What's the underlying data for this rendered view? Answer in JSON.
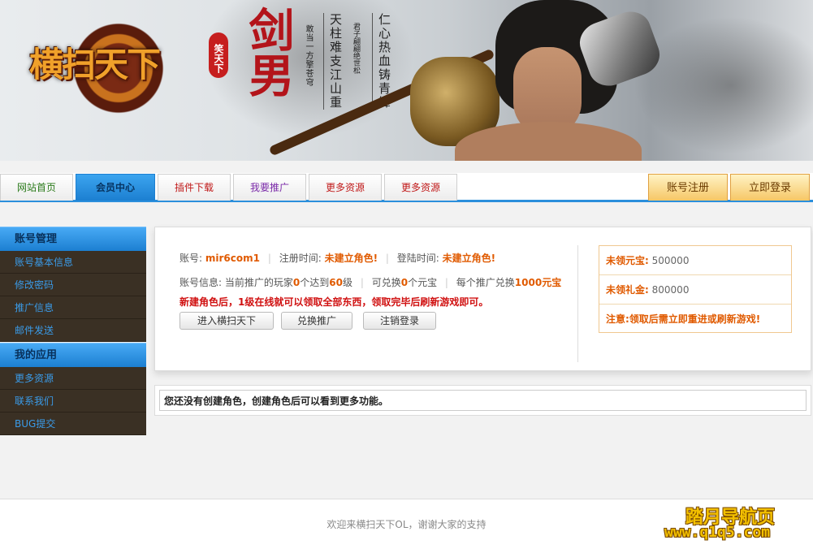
{
  "banner": {
    "logo": "横扫天下",
    "seal": "笑天下",
    "calligraphy": "剑男",
    "verse_small_1": "敢当一方擎苍穹",
    "verse_1": "天柱难支江山重",
    "verse_small_2": "君子翩翩绝世松",
    "verse_2": "仁心热血铸青锋"
  },
  "nav": {
    "tabs": [
      {
        "label": "网站首页",
        "color": "#2a7a1a"
      },
      {
        "label": "会员中心",
        "color": "#073563"
      },
      {
        "label": "插件下载",
        "color": "#c01818"
      },
      {
        "label": "我要推广",
        "color": "#7a2aa8"
      },
      {
        "label": "更多资源",
        "color": "#c01818"
      },
      {
        "label": "更多资源",
        "color": "#c01818"
      }
    ],
    "register": "账号注册",
    "login": "立即登录"
  },
  "sidebar": {
    "section1": "账号管理",
    "items1": [
      "账号基本信息",
      "修改密码",
      "推广信息",
      "邮件发送"
    ],
    "section2": "我的应用",
    "items2": [
      "更多资源",
      "联系我们",
      "BUG提交"
    ]
  },
  "panel": {
    "account_label": "账号:",
    "account": "mir6com1",
    "reg_label": "注册时间:",
    "reg_value": "未建立角色!",
    "login_label": "登陆时间:",
    "login_value": "未建立角色!",
    "info_label": "账号信息:",
    "info_a": "当前推广的玩家",
    "info_n1": "0",
    "info_b": "个达到",
    "info_n2": "60",
    "info_c": "级",
    "info_d": "可兑换",
    "info_n3": "0",
    "info_e": "个元宝",
    "info_f": "每个推广兑换",
    "info_n4": "1000元宝",
    "warning": "新建角色后，1级在线就可以领取全部东西，领取完毕后刷新游戏即可。",
    "btn_enter": "进入横扫天下",
    "btn_exchange": "兑换推广",
    "btn_logout": "注销登录",
    "box": {
      "yuanbao_label": "未领元宝:",
      "yuanbao_value": "500000",
      "gold_label": "未领礼金:",
      "gold_value": "800000",
      "note": "注意:领取后需立即重进或刷新游戏!"
    }
  },
  "notice": "您还没有创建角色，创建角色后可以看到更多功能。",
  "footer": {
    "text": "欢迎来横扫天下OL，谢谢大家的支持",
    "watermark1": "踏月导航页",
    "watermark2": "www.q1q5.com"
  }
}
